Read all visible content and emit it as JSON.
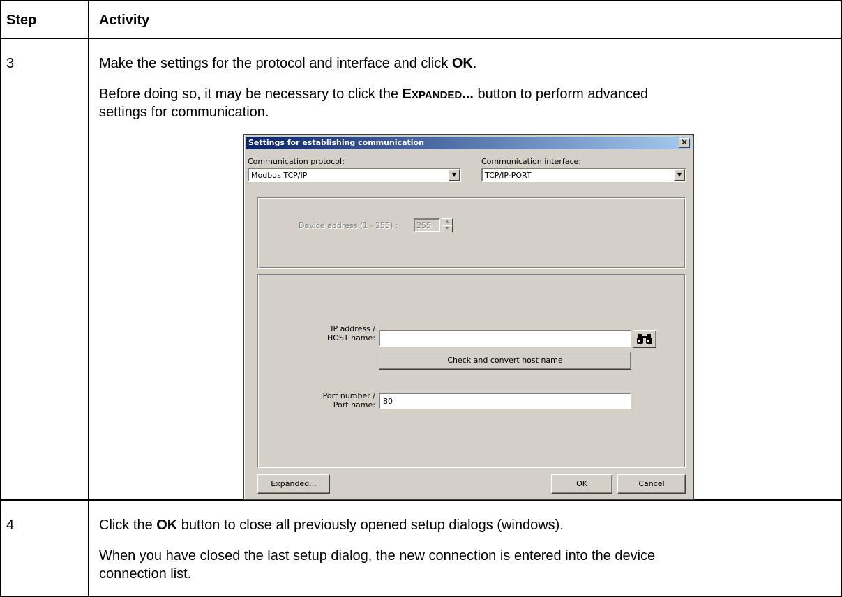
{
  "table": {
    "header": {
      "step": "Step",
      "activity": "Activity"
    },
    "rows": [
      {
        "step": "3",
        "line1_pre": "Make the settings for the protocol and interface and click ",
        "line1_bold": "OK",
        "line1_post": ".",
        "line2_pre": "Before doing so, it may be necessary to click the ",
        "line2_sc_big": "E",
        "line2_sc_small": "XPANDED",
        "line2_sc_dots": "...",
        "line2_post": " button to perform advanced",
        "line3": "settings for communication."
      },
      {
        "step": "4",
        "line1_pre": "Click the ",
        "line1_bold": "OK",
        "line1_post": " button to close all previously opened setup dialogs (windows).",
        "line2": "When you have closed the last setup dialog, the new connection is entered into the device",
        "line3": "connection list."
      }
    ]
  },
  "dialog": {
    "title": "Settings for establishing communication",
    "close_glyph": "✕",
    "protocol_label": "Communication protocol:",
    "protocol_value": "Modbus TCP/IP",
    "interface_label": "Communication interface:",
    "interface_value": "TCP/IP-PORT",
    "device_address_label": "Device address (1 - 255) :",
    "device_address_value": "255",
    "ip_label_1": "IP address /",
    "ip_label_2": "HOST name:",
    "ip_value": "",
    "check_button": "Check and convert host name",
    "port_label_1": "Port number /",
    "port_label_2": "Port name:",
    "port_value": "80",
    "expanded_button": "Expanded...",
    "ok_button": "OK",
    "cancel_button": "Cancel",
    "icons": {
      "search": "binoculars-icon",
      "dropdown": "chevron-down-icon"
    }
  }
}
